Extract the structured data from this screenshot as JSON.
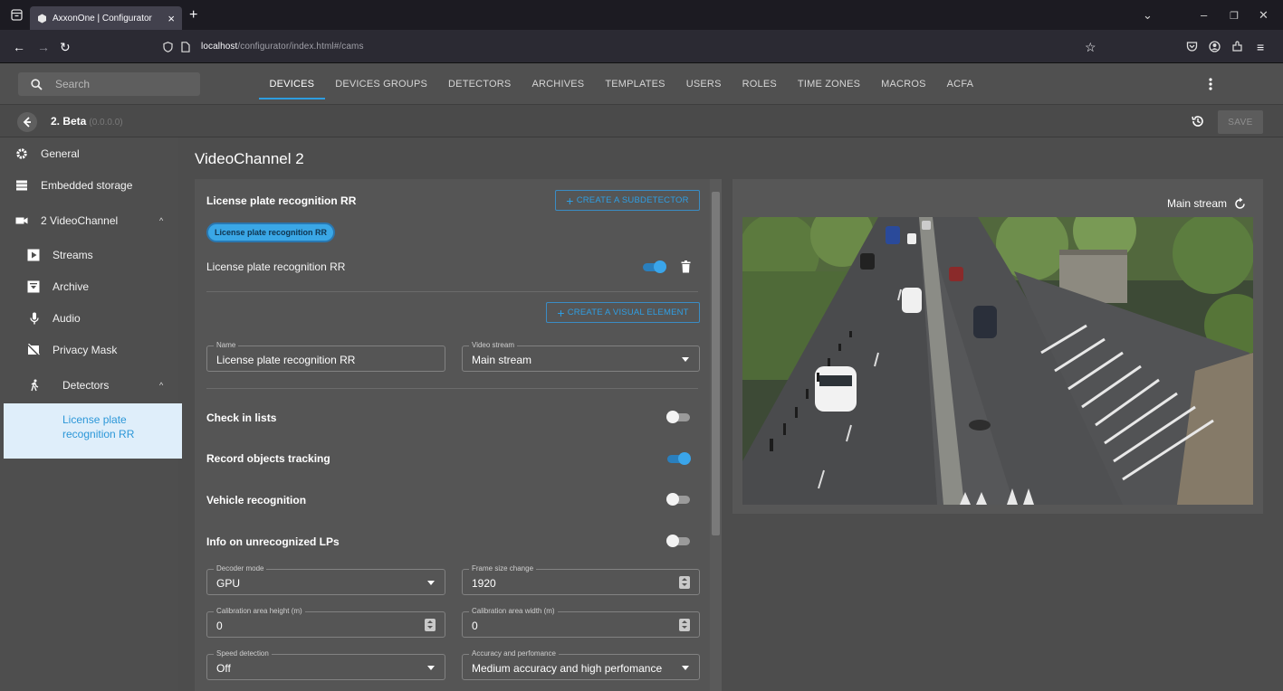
{
  "browser": {
    "tab_title": "AxxonOne | Configurator",
    "url_host": "localhost",
    "url_path": "/configurator/index.html#/cams"
  },
  "header": {
    "search_placeholder": "Search",
    "tabs": [
      "DEVICES",
      "DEVICES GROUPS",
      "DETECTORS",
      "ARCHIVES",
      "TEMPLATES",
      "USERS",
      "ROLES",
      "TIME ZONES",
      "MACROS",
      "ACFA"
    ],
    "active_tab": "DEVICES"
  },
  "subheader": {
    "device_name": "2. Beta",
    "device_ip": "(0.0.0.0)",
    "save_label": "SAVE"
  },
  "sidebar": {
    "items": [
      {
        "label": "General",
        "icon": "gear-icon"
      },
      {
        "label": "Embedded storage",
        "icon": "storage-icon"
      },
      {
        "label": "2 VideoChannel",
        "icon": "camera-icon"
      },
      {
        "label": "Streams",
        "icon": "play-icon"
      },
      {
        "label": "Archive",
        "icon": "archive-icon"
      },
      {
        "label": "Audio",
        "icon": "microphone-icon"
      },
      {
        "label": "Privacy Mask",
        "icon": "privacy-mask-icon"
      },
      {
        "label": "Detectors",
        "icon": "walker-icon"
      }
    ],
    "selected_item": "License plate recognition RR"
  },
  "main": {
    "page_title": "VideoChannel 2",
    "section_title": "License plate recognition RR",
    "create_subdetector": "CREATE A SUBDETECTOR",
    "chip_label": "License plate recognition RR",
    "detector_row_label": "License plate recognition RR",
    "detector_enabled": true,
    "create_visual_element": "CREATE A VISUAL ELEMENT",
    "fields": {
      "name": {
        "label": "Name",
        "value": "License plate recognition RR"
      },
      "video_stream": {
        "label": "Video stream",
        "value": "Main stream"
      },
      "decoder_mode": {
        "label": "Decoder mode",
        "value": "GPU"
      },
      "frame_size_change": {
        "label": "Frame size change",
        "value": "1920"
      },
      "calib_height": {
        "label": "Calibration area height (m)",
        "value": "0"
      },
      "calib_width": {
        "label": "Calibration area width (m)",
        "value": "0"
      },
      "speed_detection": {
        "label": "Speed detection",
        "value": "Off"
      },
      "accuracy": {
        "label": "Accuracy and perfomance",
        "value": "Medium accuracy and high perfomance"
      }
    },
    "toggles": [
      {
        "label": "Check in lists",
        "on": false
      },
      {
        "label": "Record objects tracking",
        "on": true
      },
      {
        "label": "Vehicle recognition",
        "on": false
      },
      {
        "label": "Info on unrecognized LPs",
        "on": false
      }
    ]
  },
  "video": {
    "stream_label": "Main stream"
  }
}
